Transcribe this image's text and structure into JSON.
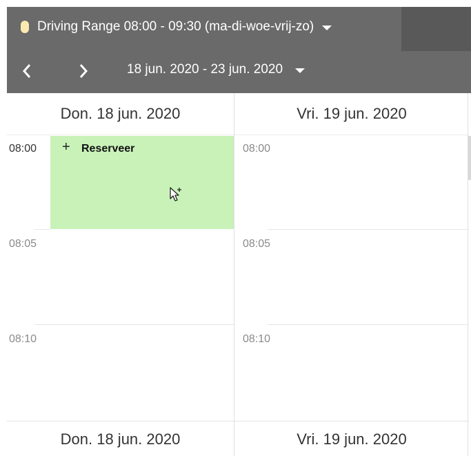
{
  "header": {
    "facility": "Driving Range 08:00 - 09:30 (ma-di-woe-vrij-zo)",
    "date_range": "18 jun. 2020 - 23 jun. 2020",
    "colors": {
      "bar": "#6a6a6a",
      "dot": "#fdeab0"
    }
  },
  "columns": [
    {
      "heading": "Don. 18 jun. 2020"
    },
    {
      "heading": "Vri. 19 jun. 2020"
    }
  ],
  "times": [
    "08:00",
    "08:05",
    "08:10"
  ],
  "slot": {
    "plus": "+",
    "label": "Reserveer",
    "color": "#c9f2b9"
  }
}
